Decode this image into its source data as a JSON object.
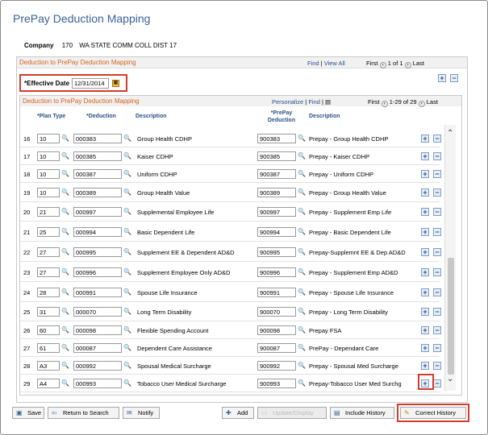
{
  "title": "PrePay Deduction Mapping",
  "company": {
    "label": "Company",
    "code": "170",
    "name": "WA STATE COMM COLL DIST 17"
  },
  "outer": {
    "section_title": "Deduction to PrePay Deduction Mapping",
    "find": "Find",
    "view_all": "View All",
    "first": "First",
    "counter": "1 of 1",
    "last": "Last"
  },
  "effective_date": {
    "label": "*Effective Date",
    "value": "12/31/2014"
  },
  "inner": {
    "section_title": "Deduction to PrePay Deduction Mapping",
    "personalize": "Personalize",
    "find": "Find",
    "first": "First",
    "counter": "1-29 of 29",
    "last": "Last"
  },
  "columns": {
    "plan_type": "*Plan Type",
    "deduction": "*Deduction",
    "description": "Description",
    "prepay_deduction": "*PrePay Deduction",
    "prepay_description": "Description"
  },
  "rows": [
    {
      "num": "16",
      "plan": "10",
      "ded": "000383",
      "desc": "Group Health CDHP",
      "pp": "900383",
      "ppdesc": "Prepay - Group Health CDHP"
    },
    {
      "num": "17",
      "plan": "10",
      "ded": "000385",
      "desc": "Kaiser CDHP",
      "pp": "900385",
      "ppdesc": "Prepay - Kaiser CDHP"
    },
    {
      "num": "18",
      "plan": "10",
      "ded": "000387",
      "desc": "Uniform CDHP",
      "pp": "900387",
      "ppdesc": "Prepay - Uniform CDHP"
    },
    {
      "num": "19",
      "plan": "10",
      "ded": "000389",
      "desc": "Group Health Value",
      "pp": "900389",
      "ppdesc": "Prepay - Group Health Value"
    },
    {
      "num": "20",
      "plan": "21",
      "ded": "000997",
      "desc": "Supplemental Employee Life",
      "pp": "900997",
      "ppdesc": "Prepay - Supplement Emp Life"
    },
    {
      "num": "21",
      "plan": "25",
      "ded": "000994",
      "desc": "Basic Dependent Life",
      "pp": "900994",
      "ppdesc": "Prepay - Basic Dependent Life"
    },
    {
      "num": "22",
      "plan": "27",
      "ded": "000995",
      "desc": "Supplement EE & Dependent AD&D",
      "pp": "900995",
      "ppdesc": "Prepay-Supplemnt EE & Dep AD&D"
    },
    {
      "num": "23",
      "plan": "27",
      "ded": "000996",
      "desc": "Supplement Employee Only AD&D",
      "pp": "900996",
      "ppdesc": "Prepay - Supplement Emp AD&D"
    },
    {
      "num": "24",
      "plan": "28",
      "ded": "000991",
      "desc": "Spouse Life Insurance",
      "pp": "900991",
      "ppdesc": "Prepay - Spouse Life Insurance"
    },
    {
      "num": "25",
      "plan": "31",
      "ded": "000070",
      "desc": "Long Term Disability",
      "pp": "900070",
      "ppdesc": "Prepay - Long Term Disability"
    },
    {
      "num": "26",
      "plan": "60",
      "ded": "000098",
      "desc": "Flexible Spending Account",
      "pp": "900098",
      "ppdesc": "Prepay FSA"
    },
    {
      "num": "27",
      "plan": "61",
      "ded": "000087",
      "desc": "Dependent Care Assistance",
      "pp": "900087",
      "ppdesc": "PrePay - Dependant Care"
    },
    {
      "num": "28",
      "plan": "A3",
      "ded": "000992",
      "desc": "Spousal Medical Surcharge",
      "pp": "900992",
      "ppdesc": "Prepay - Spousal Med Surcharge"
    },
    {
      "num": "29",
      "plan": "A4",
      "ded": "000993",
      "desc": "Tobacco User Medical Surcharge",
      "pp": "900993",
      "ppdesc": "Prepay-Tobacco User Med Surchg"
    }
  ],
  "buttons": {
    "save": "Save",
    "return": "Return to Search",
    "notify": "Notify",
    "add": "Add",
    "update": "Update/Display",
    "include": "Include History",
    "correct": "Correct History"
  }
}
